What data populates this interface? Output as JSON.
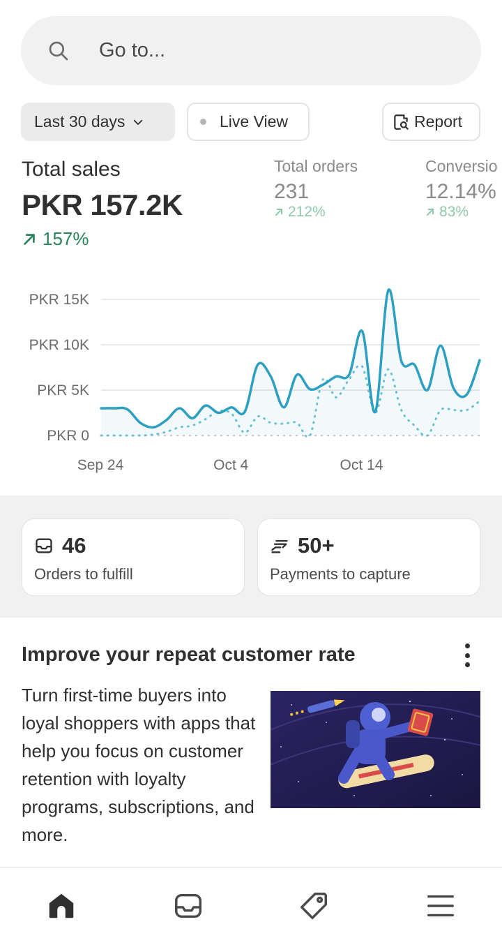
{
  "search": {
    "placeholder": "Go to..."
  },
  "filters": {
    "date_range": "Last 30 days",
    "live_view": "Live View",
    "report": "Report"
  },
  "metrics": {
    "total_sales": {
      "label": "Total sales",
      "value": "PKR 157.2K",
      "delta": "157%"
    },
    "total_orders": {
      "label": "Total orders",
      "value": "231",
      "delta": "212%"
    },
    "conversion": {
      "label": "Conversio",
      "value": "12.14%",
      "delta": "83%"
    }
  },
  "chart_data": {
    "type": "line",
    "title": "",
    "xlabel": "",
    "ylabel": "",
    "y_ticks": [
      "PKR 15K",
      "PKR 10K",
      "PKR 5K",
      "PKR 0"
    ],
    "x_ticks": [
      "Sep 24",
      "Oct 4",
      "Oct 14"
    ],
    "ylim": [
      0,
      15000
    ],
    "grid": true,
    "x": [
      1,
      2,
      3,
      4,
      5,
      6,
      7,
      8,
      9,
      10,
      11,
      12,
      13,
      14,
      15,
      16,
      17,
      18,
      19,
      20,
      21,
      22,
      23,
      24,
      25,
      26,
      27,
      28,
      29,
      30
    ],
    "series": [
      {
        "values": [
          3000,
          3000,
          2900,
          1400,
          900,
          1700,
          3000,
          1900,
          3300,
          2500,
          3100,
          2600,
          7800,
          6500,
          3100,
          6700,
          5100,
          5600,
          6500,
          6700,
          11500,
          2600,
          16000,
          8200,
          7800,
          5000,
          9900,
          5200,
          4500,
          8300
        ],
        "color": "#2d9fc0",
        "style": "solid"
      },
      {
        "values": [
          0,
          0,
          0,
          0,
          100,
          400,
          900,
          1100,
          1800,
          2700,
          2400,
          300,
          2100,
          1400,
          1300,
          1400,
          0,
          6200,
          4200,
          6200,
          7600,
          2500,
          7300,
          2800,
          1100,
          0,
          2800,
          2800,
          2800,
          3800
        ],
        "color": "#6ec3db",
        "style": "dotted"
      }
    ]
  },
  "cards": [
    {
      "value": "46",
      "label": "Orders to fulfill",
      "icon": "inbox-icon"
    },
    {
      "value": "50+",
      "label": "Payments to capture",
      "icon": "cash-icon"
    }
  ],
  "promo": {
    "title": "Improve your repeat customer rate",
    "body": "Turn first-time buyers into loyal shoppers with apps that help you focus on customer retention with loyalty programs, subscriptions, and more."
  },
  "nav": [
    "home-icon",
    "orders-icon",
    "products-icon",
    "menu-icon"
  ],
  "colors": {
    "accent_line": "#2d9fc0",
    "positive": "#29845a",
    "muted_positive": "#8fc8a8"
  }
}
